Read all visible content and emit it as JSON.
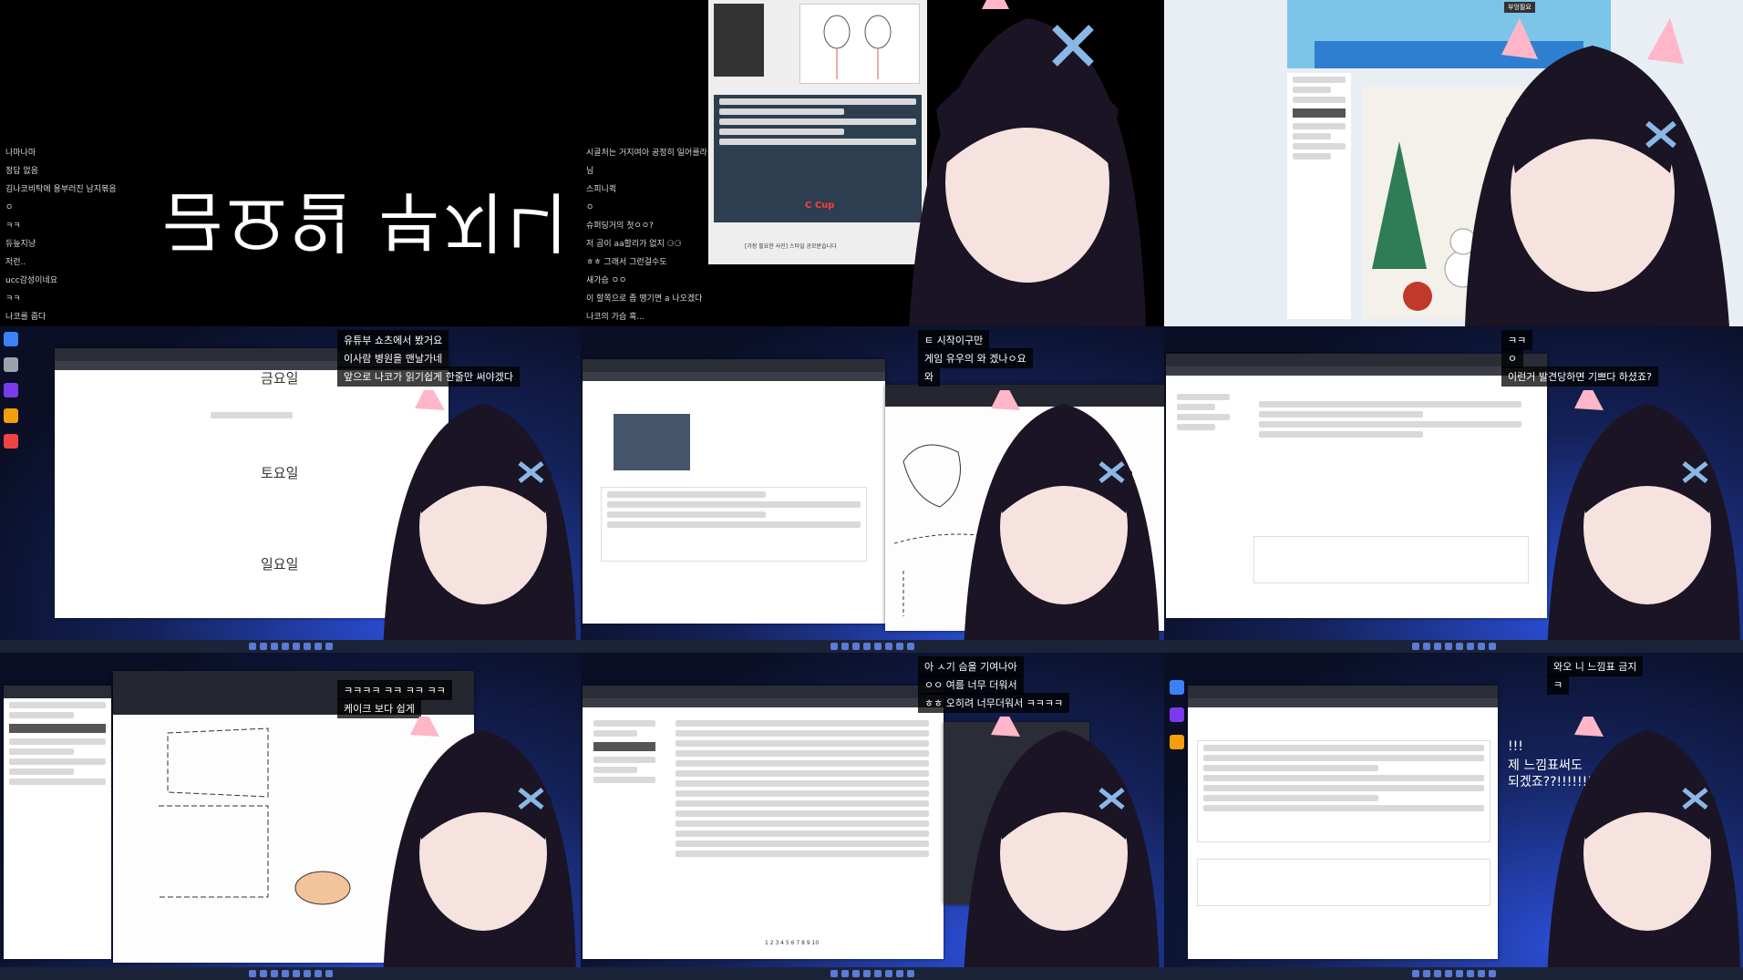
{
  "tiles": [
    {
      "chat": [
        "나마나마",
        "정답 없음",
        "김나코비탁에 용부러진 남지볶음",
        "ㅇ",
        "ㅋㅋ",
        "듀늪지냥",
        "저런..",
        "ucc감성이네요",
        "ㅋㅋ",
        "나코를 줍다"
      ],
      "big_text": "금요일 부지니 나코"
    },
    {
      "chat": [
        "시골처는 거지여아 공정히 일어를라실",
        "님",
        "스피니퀵",
        "ㅇ",
        "슈퍼딩거의 첫ㅇㅇ?",
        "저 곰이 aa할리가 없지 ⚆⚆",
        "ㅎㅎ 그래서 그런걸수도",
        "새가슴 ㅇㅇ",
        "이 할쪽으로 좀 땡기면 a 나오겠다",
        "나코의 가슴 혹..."
      ],
      "cup_label": "C Cup",
      "footer_text": "[가장 필요한 사진] 스타일 공모받습니다"
    },
    {
      "label": "부엉필요"
    },
    {
      "captions": [
        "유튜부 쇼츠에서 봤거요",
        "이사람 병원을 맨날가네",
        "앞으로 나코가 읽기쉽게 한줄만 써야겠다"
      ],
      "headings": [
        "금요일",
        "토요일",
        "일요일"
      ]
    },
    {
      "captions": [
        "ㅌ 시작이구만",
        "게임 유우의 와 겠나ㅇ요",
        "와"
      ]
    },
    {
      "captions": [
        "ㅋㅋ",
        "ㅇ",
        "이런거 발견당하면 기쁘다 하셨죠?"
      ]
    },
    {
      "captions": [
        "ㅋㅋㅋㅋ ㅋㅋ ㅋㅋ ㅋㅋ",
        "케이크 보다 쉽게"
      ]
    },
    {
      "captions": [
        "아 ㅅ기 슴을 기여나아",
        "ㅇㅇ 여름 너무 더워서",
        "ㅎㅎ 오히려 너무더워서 ㅋㅋㅋㅋ"
      ],
      "pagination": "1 2 3 4 5 6 7 8 9 10"
    },
    {
      "captions": [
        "와오 니 느낌표 금지",
        "ㅋ",
        "!!!",
        "제 느낌표써도",
        "되겠죠??!!!!!!!!!!!!!!!!"
      ]
    }
  ],
  "colors": {
    "accent_blue": "#2b4fd8",
    "text_red": "#ff3d3d",
    "chat_text": "#d8d8d8"
  }
}
